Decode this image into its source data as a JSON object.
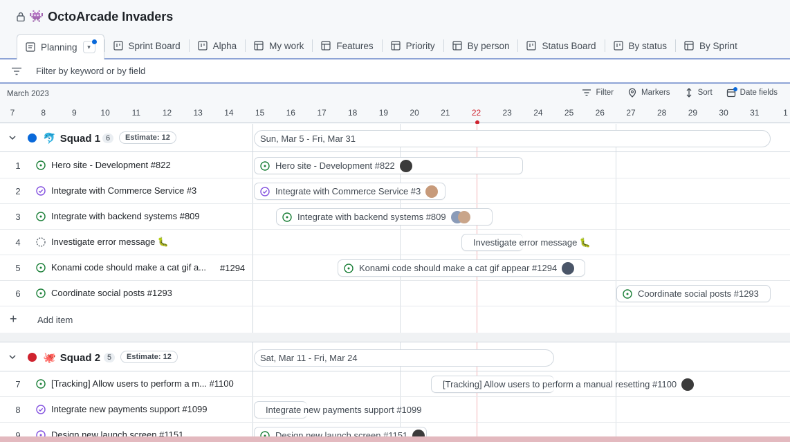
{
  "header": {
    "title": "OctoArcade Invaders",
    "emoji": "👾",
    "lock_icon": "lock-icon"
  },
  "tabs": [
    {
      "label": "Planning",
      "icon": "table-icon",
      "active": true
    },
    {
      "label": "Sprint Board",
      "icon": "board-icon"
    },
    {
      "label": "Alpha",
      "icon": "board-icon"
    },
    {
      "label": "My work",
      "icon": "table-icon"
    },
    {
      "label": "Features",
      "icon": "table-icon"
    },
    {
      "label": "Priority",
      "icon": "table-icon"
    },
    {
      "label": "By person",
      "icon": "table-icon"
    },
    {
      "label": "Status Board",
      "icon": "board-icon"
    },
    {
      "label": "By status",
      "icon": "board-icon"
    },
    {
      "label": "By Sprint",
      "icon": "table-icon"
    }
  ],
  "filter": {
    "placeholder": "Filter by keyword or by field"
  },
  "timeline": {
    "month": "March 2023",
    "tools": {
      "filter": "Filter",
      "markers": "Markers",
      "sort": "Sort",
      "date_fields": "Date fields"
    },
    "days": [
      "7",
      "8",
      "9",
      "10",
      "11",
      "12",
      "13",
      "14",
      "15",
      "16",
      "17",
      "18",
      "19",
      "20",
      "21",
      "22",
      "23",
      "24",
      "25",
      "26",
      "27",
      "28",
      "29",
      "30",
      "31",
      "1"
    ],
    "today": "22"
  },
  "groups": [
    {
      "name": "Squad 1",
      "emoji": "🐬",
      "color": "#0969da",
      "count": "6",
      "estimate": "Estimate: 12",
      "range": "Sun, Mar 5 - Fri, Mar 31",
      "items": [
        {
          "num": "1",
          "title": "Hero site - Development",
          "ref": "#822",
          "bar": "Hero site - Development #822",
          "status": "open"
        },
        {
          "num": "2",
          "title": "Integrate with Commerce Service",
          "ref": "#3",
          "bar": "Integrate with Commerce Service #3",
          "status": "done"
        },
        {
          "num": "3",
          "title": "Integrate with backend systems",
          "ref": "#809",
          "bar": "Integrate with backend systems #809",
          "status": "open"
        },
        {
          "num": "4",
          "title": "Investigate error message 🐛",
          "ref": "",
          "bar": "Investigate error message 🐛",
          "status": "draft"
        },
        {
          "num": "5",
          "title": "Konami code should make a cat gif a...",
          "ref": "#1294",
          "bar": "Konami code should make a cat gif appear #1294",
          "status": "open"
        },
        {
          "num": "6",
          "title": "Coordinate social posts",
          "ref": "#1293",
          "bar": "Coordinate social posts #1293",
          "status": "open"
        }
      ],
      "add_item": "Add item"
    },
    {
      "name": "Squad 2",
      "emoji": "🐙",
      "color": "#cf222e",
      "count": "5",
      "estimate": "Estimate: 12",
      "range": "Sat, Mar 11 - Fri, Mar 24",
      "items": [
        {
          "num": "7",
          "title": "[Tracking] Allow users to perform a m...",
          "ref": "#1100",
          "bar": "[Tracking] Allow users to perform a manual resetting #1100",
          "status": "open"
        },
        {
          "num": "8",
          "title": "Integrate new payments support",
          "ref": "#1099",
          "bar": "Integrate new payments support #1099",
          "status": "done"
        },
        {
          "num": "9",
          "title": "Design new launch screen",
          "ref": "#1151",
          "bar": "Design new launch screen #1151",
          "status": "open"
        }
      ]
    }
  ]
}
